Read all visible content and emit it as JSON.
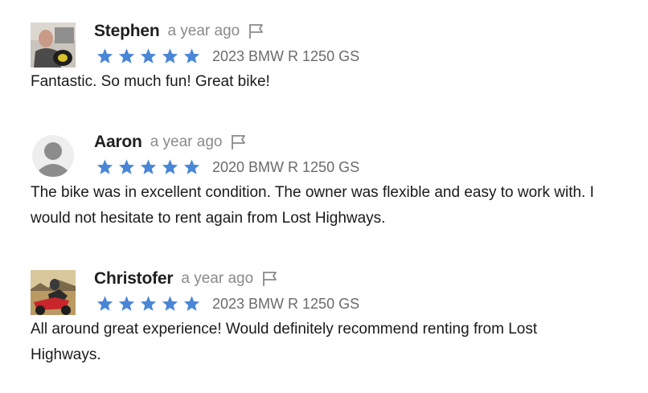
{
  "reviews": [
    {
      "name": "Stephen",
      "time": "a year ago",
      "rating": 5,
      "bike": "2023 BMW R 1250 GS",
      "text": "Fantastic. So much fun! Great bike!",
      "avatar": "photo-helmet"
    },
    {
      "name": "Aaron",
      "time": "a year ago",
      "rating": 5,
      "bike": "2020 BMW R 1250 GS",
      "text": "The bike was in excellent condition. The owner was flexible and easy to work with. I would not hesitate to rent again from Lost Highways.",
      "avatar": "default-user"
    },
    {
      "name": "Christofer",
      "time": "a year ago",
      "rating": 5,
      "bike": "2023 BMW R 1250 GS",
      "text": "All around great experience! Would definitely recommend renting from Lost Highways.",
      "avatar": "photo-motorcycle"
    }
  ],
  "colors": {
    "star": "#4a86d6",
    "muted": "#8a8a8a",
    "text": "#1a1a1a"
  },
  "icons": {
    "flag": "flag-icon",
    "star": "star-icon"
  }
}
